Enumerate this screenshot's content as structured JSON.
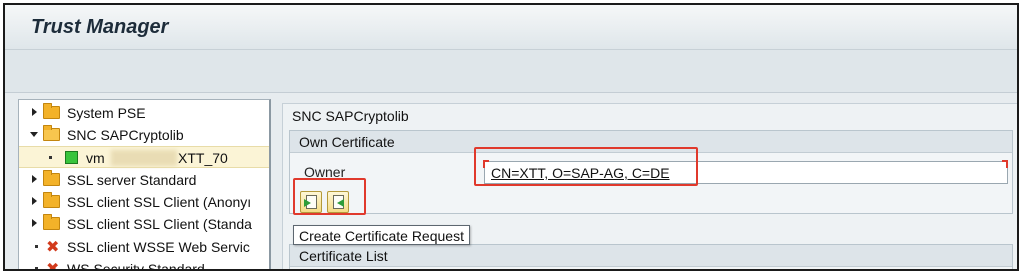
{
  "window": {
    "title": "Trust Manager"
  },
  "tree": {
    "items": [
      {
        "label": "System PSE",
        "icon": "folder-icon",
        "expanded": false
      },
      {
        "label": "SNC SAPCryptolib",
        "icon": "folder-open-icon",
        "expanded": true
      },
      {
        "label_prefix": "vm",
        "label_suffix": "XTT_70",
        "icon": "green-status-icon",
        "selected": true
      },
      {
        "label": "SSL server Standard",
        "icon": "folder-icon",
        "expanded": false
      },
      {
        "label": "SSL client SSL Client (Anonyı",
        "icon": "folder-icon",
        "expanded": false
      },
      {
        "label": "SSL client SSL Client (Standa",
        "icon": "folder-icon",
        "expanded": false
      },
      {
        "label": "SSL client WSSE Web Servic",
        "icon": "red-x-icon",
        "expanded": false
      },
      {
        "label": "WS Security Standard",
        "icon": "red-x-icon",
        "expanded": false
      }
    ]
  },
  "detail": {
    "header": "SNC SAPCryptolib",
    "own_certificate": {
      "title": "Own Certificate",
      "owner_label": "Owner",
      "owner_value": "CN=XTT, O=SAP-AG, C=DE"
    },
    "actions": {
      "create_request_tooltip": "Create Certificate Request"
    },
    "certificate_list": {
      "title": "Certificate List"
    }
  },
  "colors": {
    "highlight": "#e0392c",
    "selected_row": "#fbf4d6",
    "folder": "#f3b229",
    "status_green": "#39c43c"
  }
}
